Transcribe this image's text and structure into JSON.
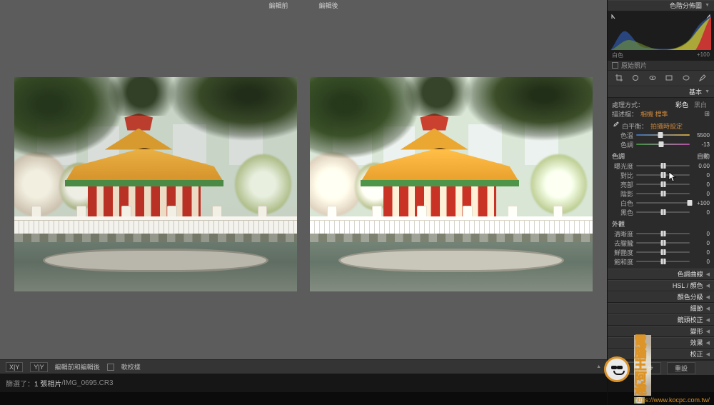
{
  "header": {
    "before_label": "編輯前",
    "after_label": "編輯後"
  },
  "side": {
    "histogram_title": "色階分佈圖",
    "hist_footer_left": "白色",
    "hist_footer_right": "+100",
    "orig_photo": "原始照片",
    "basic": {
      "title": "基本",
      "treatment_label": "處理方式：",
      "treatment_color": "彩色",
      "treatment_bw": "黑白",
      "profile_label": "描述檔：",
      "profile_value": "相機 標準",
      "wb_label": "白平衡：",
      "wb_value": "拍攝時設定",
      "temp_label": "色溫",
      "temp_value": "5500",
      "tint_label": "色調",
      "tint_value": "-13",
      "tone_title": "色調",
      "auto_label": "自動",
      "exposure_label": "曝光度",
      "exposure_value": "0.00",
      "contrast_label": "對比",
      "contrast_value": "0",
      "highlights_label": "亮部",
      "highlights_value": "0",
      "shadows_label": "陰影",
      "shadows_value": "0",
      "whites_label": "白色",
      "whites_value": "+100",
      "blacks_label": "黑色",
      "blacks_value": "0",
      "presence_title": "外觀",
      "texture_label": "清晰度",
      "texture_value": "0",
      "clarity_label": "去朦朧",
      "clarity_value": "0",
      "vibrance_label": "鮮艷度",
      "vibrance_value": "0",
      "saturation_label": "飽和度",
      "saturation_value": "0"
    },
    "collapsed": {
      "tone_curve": "色調曲線",
      "hsl": "HSL / 顏色",
      "color_grading": "顏色分級",
      "detail": "細節",
      "lens": "鏡頭校正",
      "transform": "變形",
      "effects": "效果",
      "calibration": "校正"
    },
    "prev_btn": "上一步",
    "reset_btn": "重設"
  },
  "bottom": {
    "compare_xy": "X|Y",
    "compare_yy": "Y|Y",
    "compare_label": "編輯前和編輯後",
    "soft_proof": "軟校樣"
  },
  "status": {
    "prefix": "篩選了：",
    "count": "1 張相片",
    "filename": "/IMG_0695.CR3"
  },
  "watermark": {
    "title": "電腦王阿達",
    "url": "https://www.kocpc.com.tw/"
  }
}
